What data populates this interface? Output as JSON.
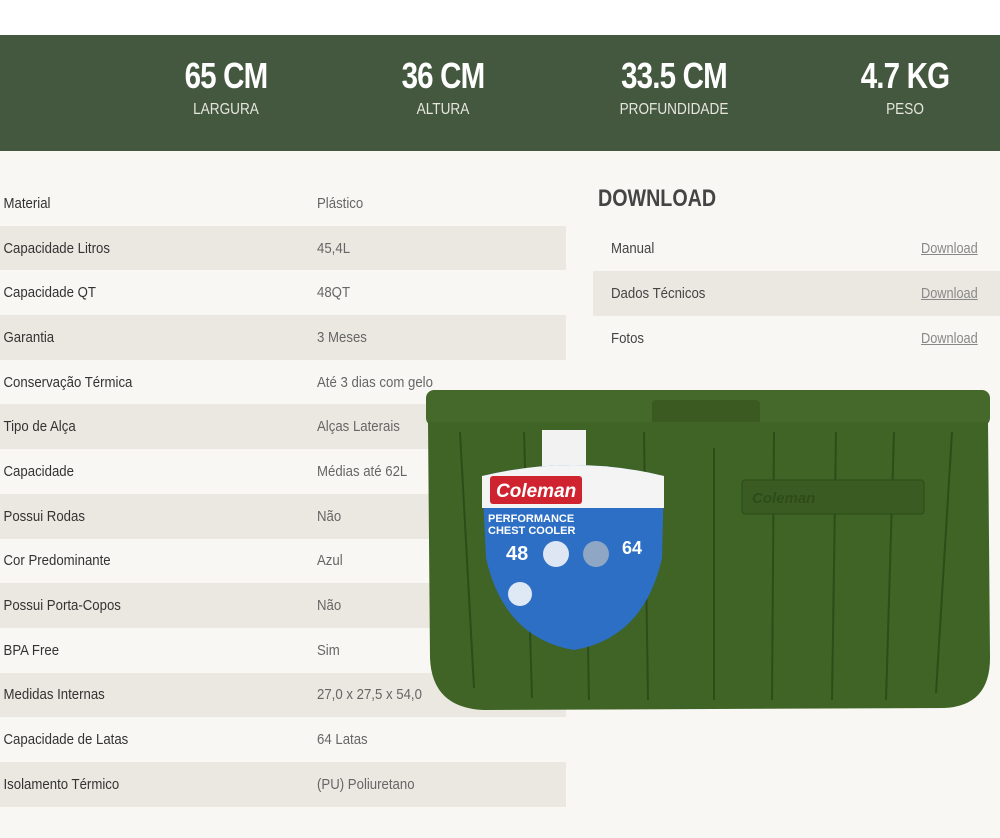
{
  "stats": [
    {
      "value": "65 CM",
      "label": "LARGURA"
    },
    {
      "value": "36 CM",
      "label": "ALTURA"
    },
    {
      "value": "33.5 CM",
      "label": "PROFUNDIDADE"
    },
    {
      "value": "4.7 KG",
      "label": "PESO"
    }
  ],
  "specs": [
    {
      "k": "Material",
      "v": "Plástico"
    },
    {
      "k": "Capacidade Litros",
      "v": "45,4L"
    },
    {
      "k": "Capacidade QT",
      "v": "48QT"
    },
    {
      "k": "Garantia",
      "v": "3 Meses"
    },
    {
      "k": "Conservação Térmica",
      "v": "Até 3 dias com gelo"
    },
    {
      "k": "Tipo de Alça",
      "v": "Alças Laterais"
    },
    {
      "k": "Capacidade",
      "v": "Médias até 62L"
    },
    {
      "k": "Possui Rodas",
      "v": "Não"
    },
    {
      "k": "Cor Predominante",
      "v": "Azul"
    },
    {
      "k": "Possui Porta-Copos",
      "v": "Não"
    },
    {
      "k": "BPA Free",
      "v": "Sim"
    },
    {
      "k": "Medidas Internas",
      "v": "27,0 x 27,5 x 54,0"
    },
    {
      "k": "Capacidade de Latas",
      "v": "64 Latas"
    },
    {
      "k": "Isolamento Térmico",
      "v": "(PU) Poliuretano"
    }
  ],
  "download": {
    "title": "DOWNLOAD",
    "items": [
      {
        "name": "Manual",
        "link": "Download"
      },
      {
        "name": "Dados Técnicos",
        "link": "Download"
      },
      {
        "name": "Fotos",
        "link": "Download"
      }
    ]
  },
  "product_image": {
    "brand": "Coleman",
    "line1": "PERFORMANCE",
    "line2": "CHEST COOLER",
    "quart": "48",
    "cans": "64"
  },
  "colors": {
    "band": "#44583f",
    "stripe": "#ebe8e1",
    "cooler": "#3f6425",
    "label": "#2d6fc4"
  }
}
